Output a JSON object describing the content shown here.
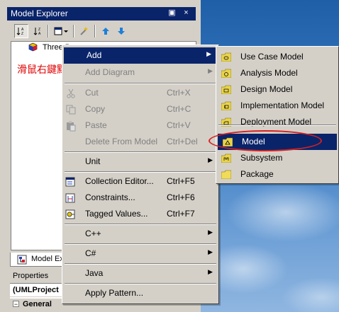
{
  "explorer": {
    "title": "Model Explorer",
    "title_controls": [
      "▣",
      "×"
    ],
    "toolbar_icons": [
      "sort-icon",
      "sort-reverse-icon",
      "view-options-icon",
      "filter-icon",
      "move-up-icon",
      "move-down-icon"
    ],
    "tree_node_label": "Three Bear",
    "annotation": "滑鼠右鍵點選專案",
    "tab_label": "Model Exp"
  },
  "properties": {
    "title": "Properties",
    "row1": "(UMLProject",
    "row2_sign": "−",
    "row2": "General"
  },
  "context_menu": {
    "items": [
      {
        "label": "Add",
        "shortcut": "",
        "submenu": true,
        "disabled": false,
        "highlighted": true
      },
      {
        "label": "Add Diagram",
        "shortcut": "",
        "submenu": true,
        "disabled": true
      },
      {
        "label": "Cut",
        "shortcut": "Ctrl+X",
        "disabled": true
      },
      {
        "label": "Copy",
        "shortcut": "Ctrl+C",
        "disabled": true
      },
      {
        "label": "Paste",
        "shortcut": "Ctrl+V",
        "disabled": true
      },
      {
        "label": "Delete From Model",
        "shortcut": "Ctrl+Del",
        "disabled": true
      },
      {
        "label": "Unit",
        "shortcut": "",
        "submenu": true
      },
      {
        "label": "Collection Editor...",
        "shortcut": "Ctrl+F5"
      },
      {
        "label": "Constraints...",
        "shortcut": "Ctrl+F6"
      },
      {
        "label": "Tagged Values...",
        "shortcut": "Ctrl+F7"
      },
      {
        "label": "C++",
        "shortcut": "",
        "submenu": true
      },
      {
        "label": "C#",
        "shortcut": "",
        "submenu": true
      },
      {
        "label": "Java",
        "shortcut": "",
        "submenu": true
      },
      {
        "label": "Apply Pattern...",
        "shortcut": ""
      }
    ]
  },
  "add_submenu": {
    "items": [
      {
        "label": "Use Case Model"
      },
      {
        "label": "Analysis Model"
      },
      {
        "label": "Design Model"
      },
      {
        "label": "Implementation Model"
      },
      {
        "label": "Deployment Model"
      },
      {
        "label": "Model",
        "highlighted": true
      },
      {
        "label": "Subsystem"
      },
      {
        "label": "Package"
      }
    ]
  },
  "colors": {
    "highlight": "#0a246a",
    "annotation": "#e00000",
    "ring": "#d62020"
  }
}
